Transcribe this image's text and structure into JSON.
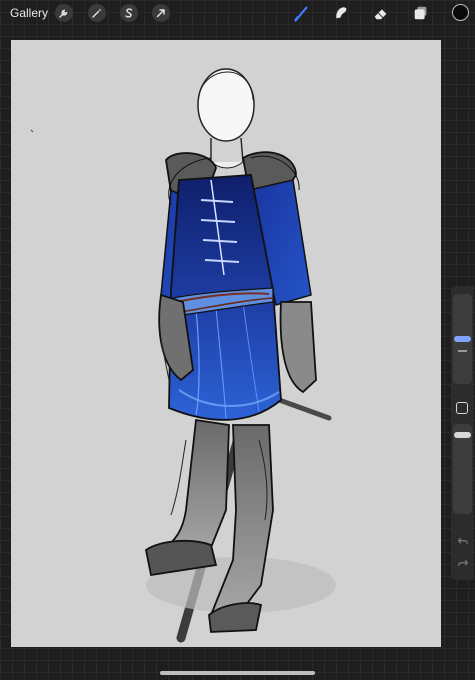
{
  "topbar": {
    "gallery_label": "Gallery",
    "left_tools": [
      {
        "icon": "wrench-icon"
      },
      {
        "icon": "magic-wand-icon"
      },
      {
        "icon": "selection-s-icon"
      },
      {
        "icon": "transform-arrow-icon"
      }
    ],
    "right_tools": [
      {
        "icon": "brush-icon",
        "active": true
      },
      {
        "icon": "smudge-icon",
        "active": false
      },
      {
        "icon": "eraser-icon",
        "active": false
      },
      {
        "icon": "layers-icon",
        "active": false
      }
    ],
    "current_color": "#0a0a0a"
  },
  "colors": {
    "active_tool": "#3f7bff",
    "canvas_bg": "#d2d2d2",
    "tunic_blue": "#1f3fa8",
    "tunic_dark": "#0e1f6b"
  },
  "sidebar": {
    "brush_size": 0.2,
    "opacity": 1.0
  }
}
